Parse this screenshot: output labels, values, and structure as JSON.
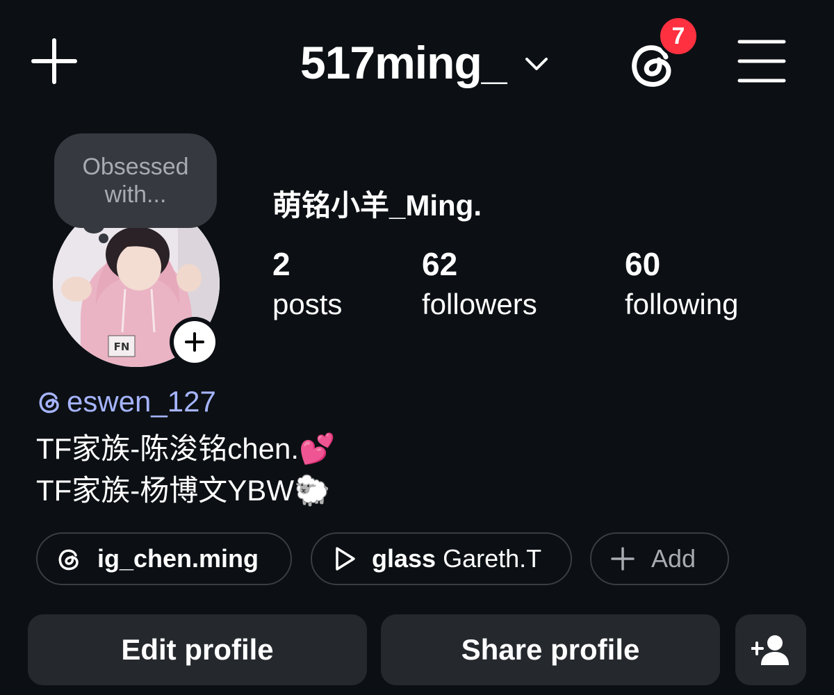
{
  "header": {
    "username": "517ming_",
    "notification_count": "7"
  },
  "profile": {
    "note": "Obsessed with...",
    "display_name": "萌铭小羊_Ming.",
    "stats": [
      {
        "value": "2",
        "label": "posts"
      },
      {
        "value": "62",
        "label": "followers"
      },
      {
        "value": "60",
        "label": "following"
      }
    ],
    "threads_handle": "eswen_127",
    "bio_lines": [
      "TF家族-陈浚铭chen.💕",
      "TF家族-杨博文YBW🐑"
    ]
  },
  "chips": {
    "threads_link": "ig_chen.ming",
    "music_title": "glass",
    "music_artist": "Gareth.T",
    "add_label": "Add"
  },
  "actions": {
    "edit_profile": "Edit profile",
    "share_profile": "Share profile"
  },
  "colors": {
    "background": "#0c1014",
    "badge": "#ff3040",
    "link": "#a6b4ff",
    "button": "#25292e"
  },
  "icons": [
    "plus-icon",
    "chevron-down-icon",
    "threads-icon",
    "menu-icon",
    "add-story-icon",
    "play-icon",
    "add-user-icon"
  ]
}
